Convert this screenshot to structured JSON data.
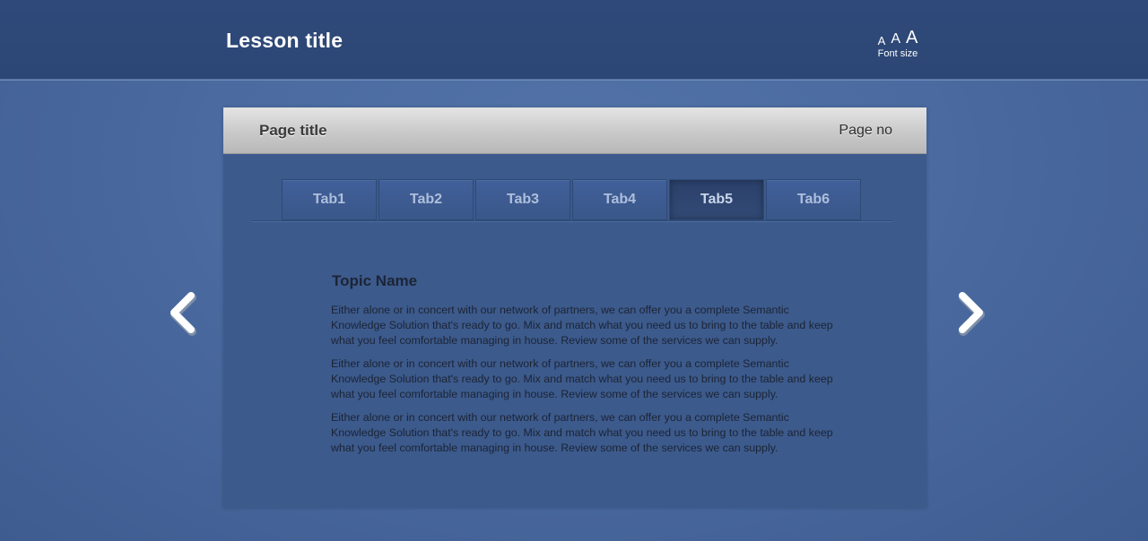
{
  "header": {
    "lesson_title": "Lesson title",
    "font_size": {
      "small": "A",
      "medium": "A",
      "large": "A",
      "label": "Font size"
    }
  },
  "page": {
    "title": "Page title",
    "page_no": "Page no"
  },
  "tabs": [
    {
      "label": "Tab1",
      "active": false
    },
    {
      "label": "Tab2",
      "active": false
    },
    {
      "label": "Tab3",
      "active": false
    },
    {
      "label": "Tab4",
      "active": false
    },
    {
      "label": "Tab5",
      "active": true
    },
    {
      "label": "Tab6",
      "active": false
    }
  ],
  "content": {
    "topic_name": "Topic Name",
    "paragraphs": [
      "Either alone or in concert with our network of partners, we can offer you a complete Semantic Knowledge Solution that's ready to go. Mix and match what you need us to bring to the table and keep what you feel comfortable managing in house. Review some of the services we can supply.",
      "Either alone or in concert with our network of partners, we can offer you a complete Semantic Knowledge Solution that's ready to go. Mix and match what you need us to bring to the table and keep what you feel comfortable managing in house. Review some of the services we can supply.",
      "Either alone or in concert with our network of partners, we can offer you a complete Semantic Knowledge Solution that's ready to go. Mix and match what you need us to bring to the table and keep what you feel comfortable managing in house. Review some of the services we can supply."
    ]
  },
  "navigation": {
    "prev_icon": "chevron-left-icon",
    "next_icon": "chevron-right-icon"
  },
  "colors": {
    "header_bg": "#2e4877",
    "page_bg": "#4a6aa0",
    "panel_bg": "#3c5a8b",
    "text": "#1c2436"
  }
}
